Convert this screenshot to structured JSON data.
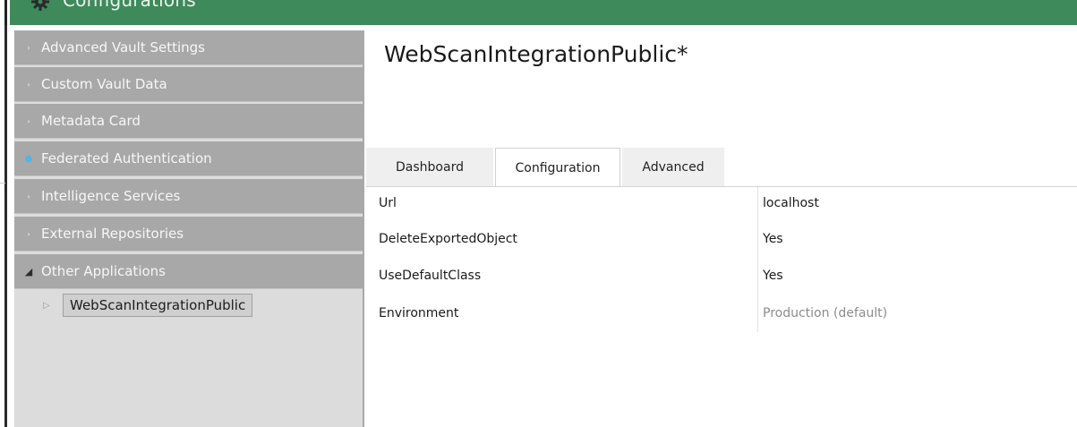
{
  "window": {
    "title": "Configurations"
  },
  "sidebar": {
    "items": [
      {
        "label": "Advanced Vault Settings",
        "arrow": "›"
      },
      {
        "label": "Custom Vault Data",
        "arrow": "›"
      },
      {
        "label": "Metadata Card",
        "arrow": "›"
      },
      {
        "label": "Federated Authentication",
        "arrow": "●"
      },
      {
        "label": "Intelligence Services",
        "arrow": "›"
      },
      {
        "label": "External Repositories",
        "arrow": "›"
      },
      {
        "label": "Other Applications",
        "arrow": "◢"
      }
    ],
    "selected_child": {
      "label": "WebScanIntegrationPublic",
      "marker": "▷"
    }
  },
  "main": {
    "title": "WebScanIntegrationPublic*",
    "tabs": [
      {
        "label": "Dashboard"
      },
      {
        "label": "Configuration"
      },
      {
        "label": "Advanced"
      }
    ],
    "active_tab": "Configuration",
    "properties": [
      {
        "key": "Url",
        "value": "localhost"
      },
      {
        "key": "DeleteExportedObject",
        "value": "Yes"
      },
      {
        "key": "UseDefaultClass",
        "value": "Yes"
      },
      {
        "key": "Environment",
        "value": "Production (default)"
      }
    ]
  },
  "colors": {
    "titlebar": "#3e8a5a",
    "sidebar_item": "#a8a8a8",
    "sidebar_bg": "#dcdcdc",
    "accent_blue": "#4fb4ec"
  }
}
